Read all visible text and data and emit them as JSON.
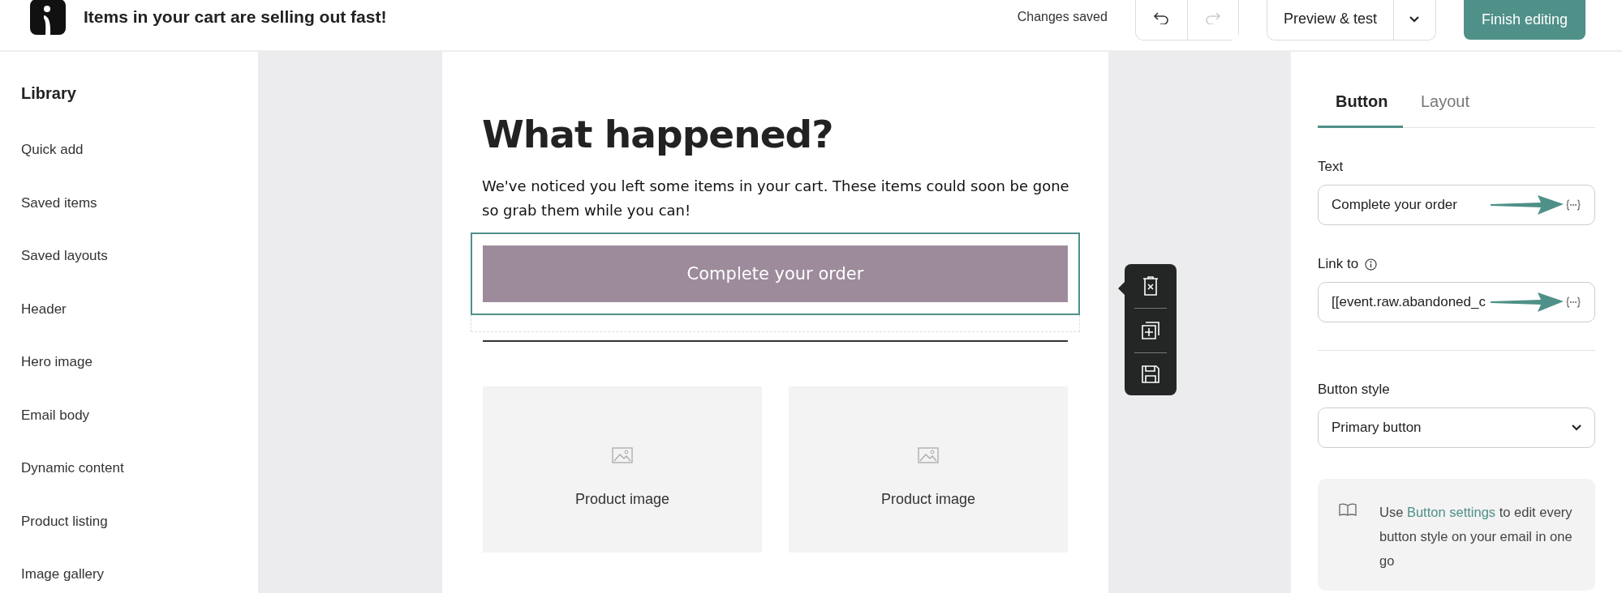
{
  "header": {
    "title": "Items in your cart are selling out fast!",
    "save_status": "Changes saved",
    "history": [
      {
        "kind": "undo",
        "disabled": false
      },
      {
        "kind": "redo",
        "disabled": true
      }
    ],
    "preview_button": "Preview & test",
    "finish_button": "Finish editing"
  },
  "sidebar": {
    "title": "Library",
    "items": [
      "Quick add",
      "Saved items",
      "Saved layouts",
      "Header",
      "Hero image",
      "Email body",
      "Dynamic content",
      "Product listing",
      "Image gallery"
    ]
  },
  "email": {
    "heading": "What happened?",
    "body": "We've noticed you left some items in your cart. These items could soon be gone so grab them while you can!",
    "button": {
      "label": "Complete your order",
      "selected": true
    },
    "products": [
      {
        "label": "Product image"
      },
      {
        "label": "Product image"
      }
    ]
  },
  "panel": {
    "tabs": [
      {
        "label": "Button",
        "selected": true
      },
      {
        "label": "Layout",
        "selected": false
      }
    ],
    "fields": [
      {
        "label": "Text",
        "info": false,
        "value": "Complete your order"
      },
      {
        "label": "Link to",
        "info": true,
        "value": "[[event.raw.abandoned_c"
      }
    ],
    "style_label": "Button style",
    "style_value": "Primary button",
    "tip": {
      "before": "Use ",
      "link": "Button settings",
      "after": " to edit every button style on your email in one go"
    }
  }
}
